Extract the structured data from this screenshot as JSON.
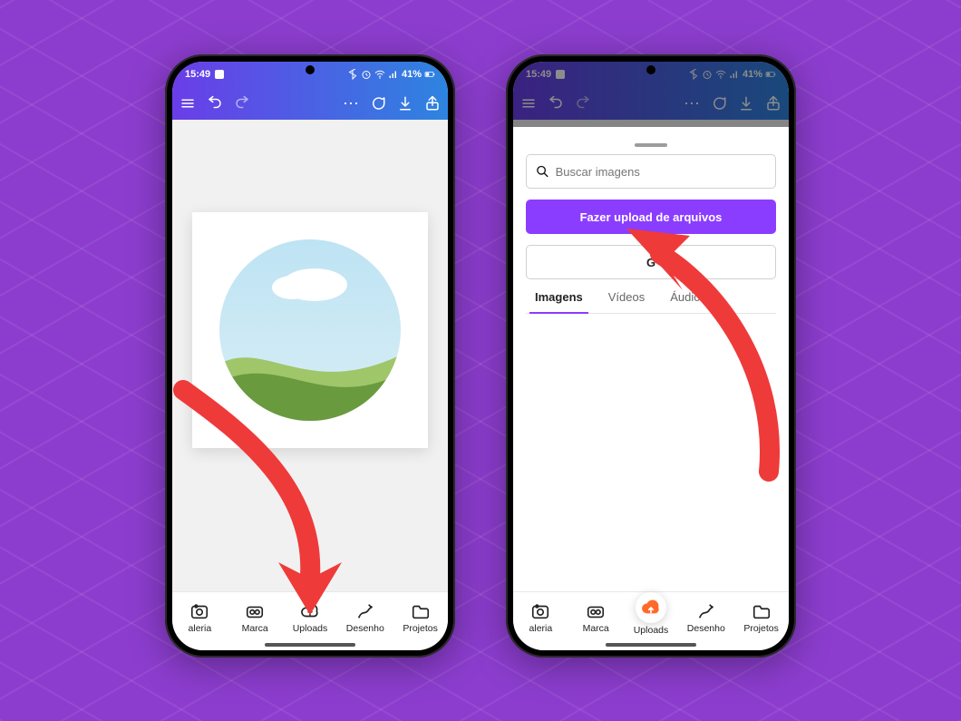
{
  "status": {
    "time": "15:49",
    "battery": "41%"
  },
  "bottom_nav": {
    "items": [
      {
        "label": "aleria"
      },
      {
        "label": "Marca"
      },
      {
        "label": "Uploads"
      },
      {
        "label": "Desenho"
      },
      {
        "label": "Projetos"
      }
    ]
  },
  "sheet": {
    "search_placeholder": "Buscar imagens",
    "upload_button": "Fazer upload de arquivos",
    "secondary_button": "G",
    "tabs": [
      {
        "label": "Imagens"
      },
      {
        "label": "Vídeos"
      },
      {
        "label": "Áudios"
      }
    ]
  }
}
